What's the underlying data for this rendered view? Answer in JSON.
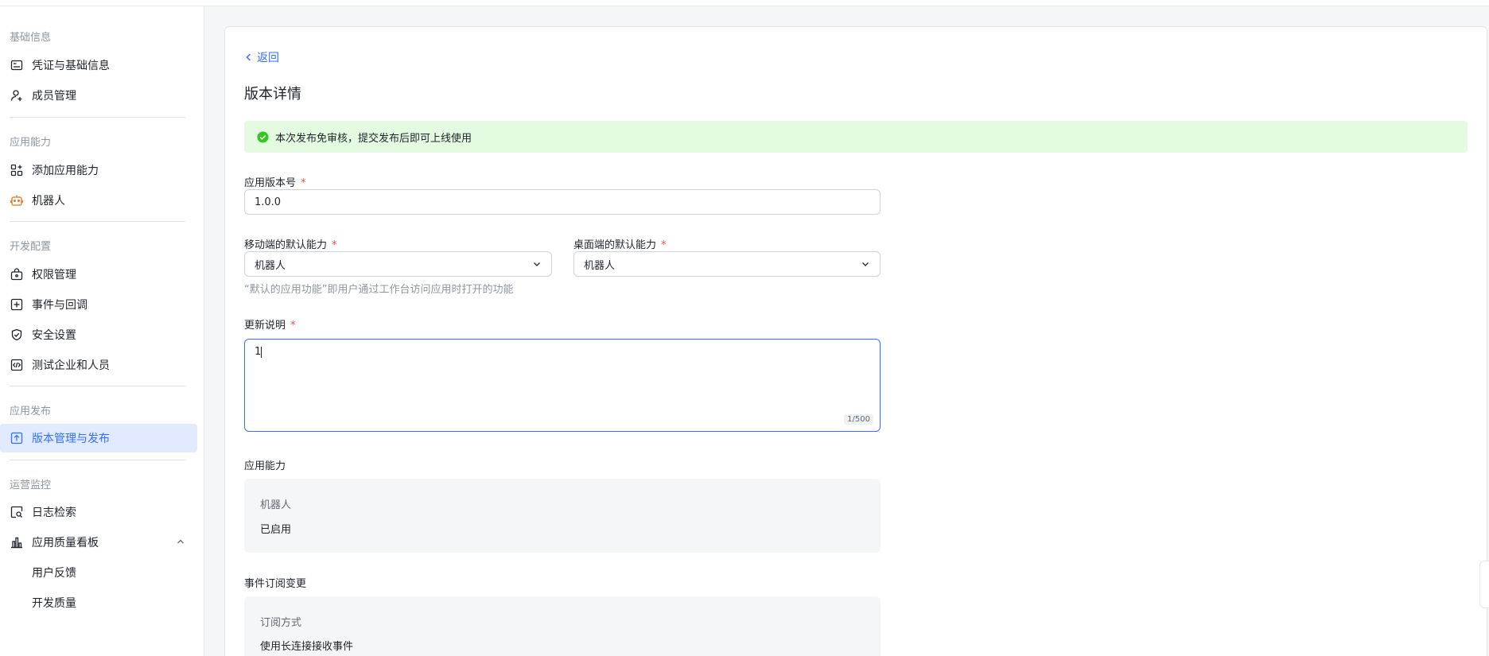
{
  "sidebar": {
    "sections": [
      {
        "title": "基础信息",
        "items": [
          {
            "label": "凭证与基础信息",
            "icon": "credential-icon"
          },
          {
            "label": "成员管理",
            "icon": "add-member-icon"
          }
        ]
      },
      {
        "title": "应用能力",
        "items": [
          {
            "label": "添加应用能力",
            "icon": "apps-grid-icon"
          },
          {
            "label": "机器人",
            "icon": "robot-icon"
          }
        ]
      },
      {
        "title": "开发配置",
        "items": [
          {
            "label": "权限管理",
            "icon": "lock-briefcase-icon"
          },
          {
            "label": "事件与回调",
            "icon": "event-icon"
          },
          {
            "label": "安全设置",
            "icon": "shield-icon"
          },
          {
            "label": "测试企业和人员",
            "icon": "code-icon"
          }
        ]
      },
      {
        "title": "应用发布",
        "items": [
          {
            "label": "版本管理与发布",
            "icon": "upload-icon"
          }
        ]
      },
      {
        "title": "运营监控",
        "items": [
          {
            "label": "日志检索",
            "icon": "log-search-icon"
          },
          {
            "label": "应用质量看板",
            "icon": "bar-chart-icon"
          },
          {
            "label": "用户反馈"
          },
          {
            "label": "开发质量"
          }
        ]
      }
    ]
  },
  "main": {
    "back_label": "返回",
    "title": "版本详情",
    "alert_text": "本次发布免审核，提交发布后即可上线使用",
    "version": {
      "label": "应用版本号",
      "value": "1.0.0"
    },
    "mobile_default": {
      "label": "移动端的默认能力",
      "value": "机器人"
    },
    "desktop_default": {
      "label": "桌面端的默认能力",
      "value": "机器人"
    },
    "default_hint": "“默认的应用功能”即用户通过工作台访问应用时打开的功能",
    "update_notes": {
      "label": "更新说明",
      "value": "1",
      "counter": "1/500"
    },
    "capabilities": {
      "heading": "应用能力",
      "key": "机器人",
      "value": "已启用"
    },
    "events": {
      "heading": "事件订阅变更",
      "key": "订阅方式",
      "value": "使用长连接接收事件"
    },
    "required_mark": "*"
  },
  "colors": {
    "accent": "#3370ff",
    "success": "#34c724",
    "required": "#f54a45",
    "robot_icon": "#e37318"
  }
}
